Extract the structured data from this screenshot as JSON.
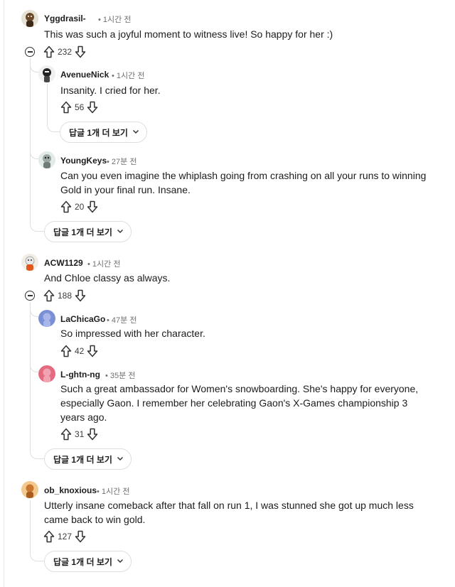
{
  "comments": [
    {
      "username": "Yggdrasil-",
      "time": "1시간 전",
      "text": "This was such a joyful moment to witness live! So happy for her :)",
      "votes": "232",
      "replies": [
        {
          "username": "AvenueNick",
          "time": "1시간 전",
          "text": "Insanity. I cried for her.",
          "votes": "56"
        },
        {
          "username": "YoungKeys",
          "time": "27분 전",
          "text": "Can you even imagine the whiplash going from crashing on all your runs to winning Gold in your final run. Insane.",
          "votes": "20"
        }
      ]
    },
    {
      "username": "ACW1129",
      "time": "1시간 전",
      "text": "And Chloe classy as always.",
      "votes": "188",
      "replies": [
        {
          "username": "LaChicaGo",
          "time": "47분 전",
          "text": "So impressed with her character.",
          "votes": "42"
        },
        {
          "username": "L-ghtn-ng",
          "time": "35분 전",
          "text": "Such a great ambassador for Women's snowboarding. She's happy for everyone, especially Gaon. I remember her celebrating Gaon's X-Games championship 3 years ago.",
          "votes": "31"
        }
      ]
    },
    {
      "username": "ob_knoxious",
      "time": "1시간 전",
      "text": "Utterly insane comeback after that fall on run 1, I was stunned she got up much less came back to win gold.",
      "votes": "127",
      "replies": []
    }
  ],
  "more_replies_label": "답글 1개 더 보기",
  "separator": "•",
  "colors": {
    "upvote": "#333333",
    "thread_line": "#dcdfe2",
    "meta": "#707070"
  }
}
